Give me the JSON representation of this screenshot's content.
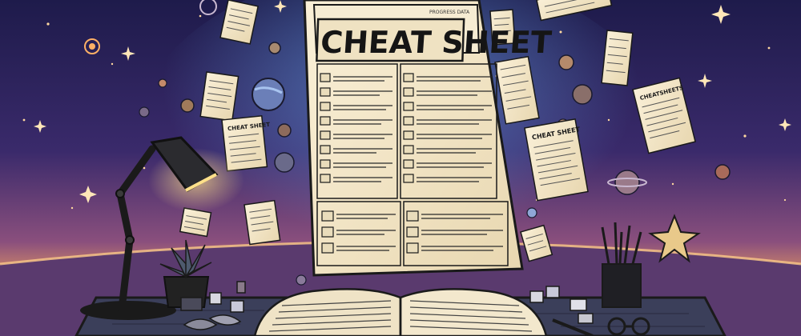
{
  "poster": {
    "title": "CHEAT SHEET",
    "tag": "PROGRESS DATA"
  },
  "floating_sheets": {
    "left_title": "CHEAT SHEET",
    "right_title": "CHEAT SHEET",
    "far_right_title": "CHEATSHEETS"
  },
  "colors": {
    "sky_top": "#1e1b4b",
    "sky_mid": "#3a2a6b",
    "horizon_glow": "#f0a35e",
    "paper": "#f3e6c8",
    "ink": "#1a1a1a",
    "desk": "#3b3f5a"
  }
}
